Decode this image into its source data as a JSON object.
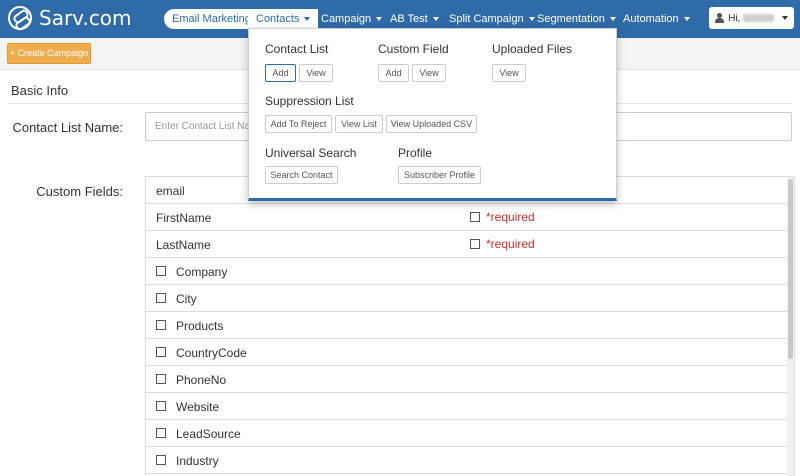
{
  "app": {
    "logo_text": "Sarv.com"
  },
  "nav": {
    "items": [
      {
        "label": "Email Marketing",
        "dropdown": false
      },
      {
        "label": "Contacts",
        "dropdown": true
      },
      {
        "label": "Campaign",
        "dropdown": true
      },
      {
        "label": "AB Test",
        "dropdown": true
      },
      {
        "label": "Split Campaign",
        "dropdown": true
      },
      {
        "label": "Segmentation",
        "dropdown": true
      },
      {
        "label": "Automation",
        "dropdown": true
      }
    ],
    "user_greeting": "Hi,"
  },
  "toolbar": {
    "create_campaign_label": "+ Create Campaign"
  },
  "section": {
    "title": "Basic Info"
  },
  "form": {
    "contact_list_name_label": "Contact List Name:",
    "contact_list_name_placeholder": "Enter Contact List Name",
    "custom_fields_label": "Custom Fields:"
  },
  "fields": {
    "required_label": "*required",
    "rows": [
      {
        "name": "email",
        "checkbox": false,
        "required_option": false
      },
      {
        "name": "FirstName",
        "checkbox": false,
        "required_option": true
      },
      {
        "name": "LastName",
        "checkbox": false,
        "required_option": true
      },
      {
        "name": "Company",
        "checkbox": true,
        "required_option": false
      },
      {
        "name": "City",
        "checkbox": true,
        "required_option": false
      },
      {
        "name": "Products",
        "checkbox": true,
        "required_option": false
      },
      {
        "name": "CountryCode",
        "checkbox": true,
        "required_option": false
      },
      {
        "name": "PhoneNo",
        "checkbox": true,
        "required_option": false
      },
      {
        "name": "Website",
        "checkbox": true,
        "required_option": false
      },
      {
        "name": "LeadSource",
        "checkbox": true,
        "required_option": false
      },
      {
        "name": "Industry",
        "checkbox": true,
        "required_option": false
      }
    ]
  },
  "contacts_menu": {
    "contact_list": {
      "heading": "Contact List",
      "add": "Add",
      "view": "View"
    },
    "custom_field": {
      "heading": "Custom Field",
      "add": "Add",
      "view": "View"
    },
    "uploaded_files": {
      "heading": "Uploaded Files",
      "view": "View"
    },
    "suppression_list": {
      "heading": "Suppression List",
      "add_to_reject": "Add To Reject",
      "view_list": "View List",
      "view_uploaded_csv": "View Uploaded CSV"
    },
    "universal_search": {
      "heading": "Universal Search",
      "search_contact": "Search Contact"
    },
    "profile": {
      "heading": "Profile",
      "subscriber_profile": "Subscriber Profile"
    }
  },
  "colors": {
    "navbar": "#2f6ba8",
    "accent_button": "#f0ad4e",
    "required": "#c9302c"
  }
}
